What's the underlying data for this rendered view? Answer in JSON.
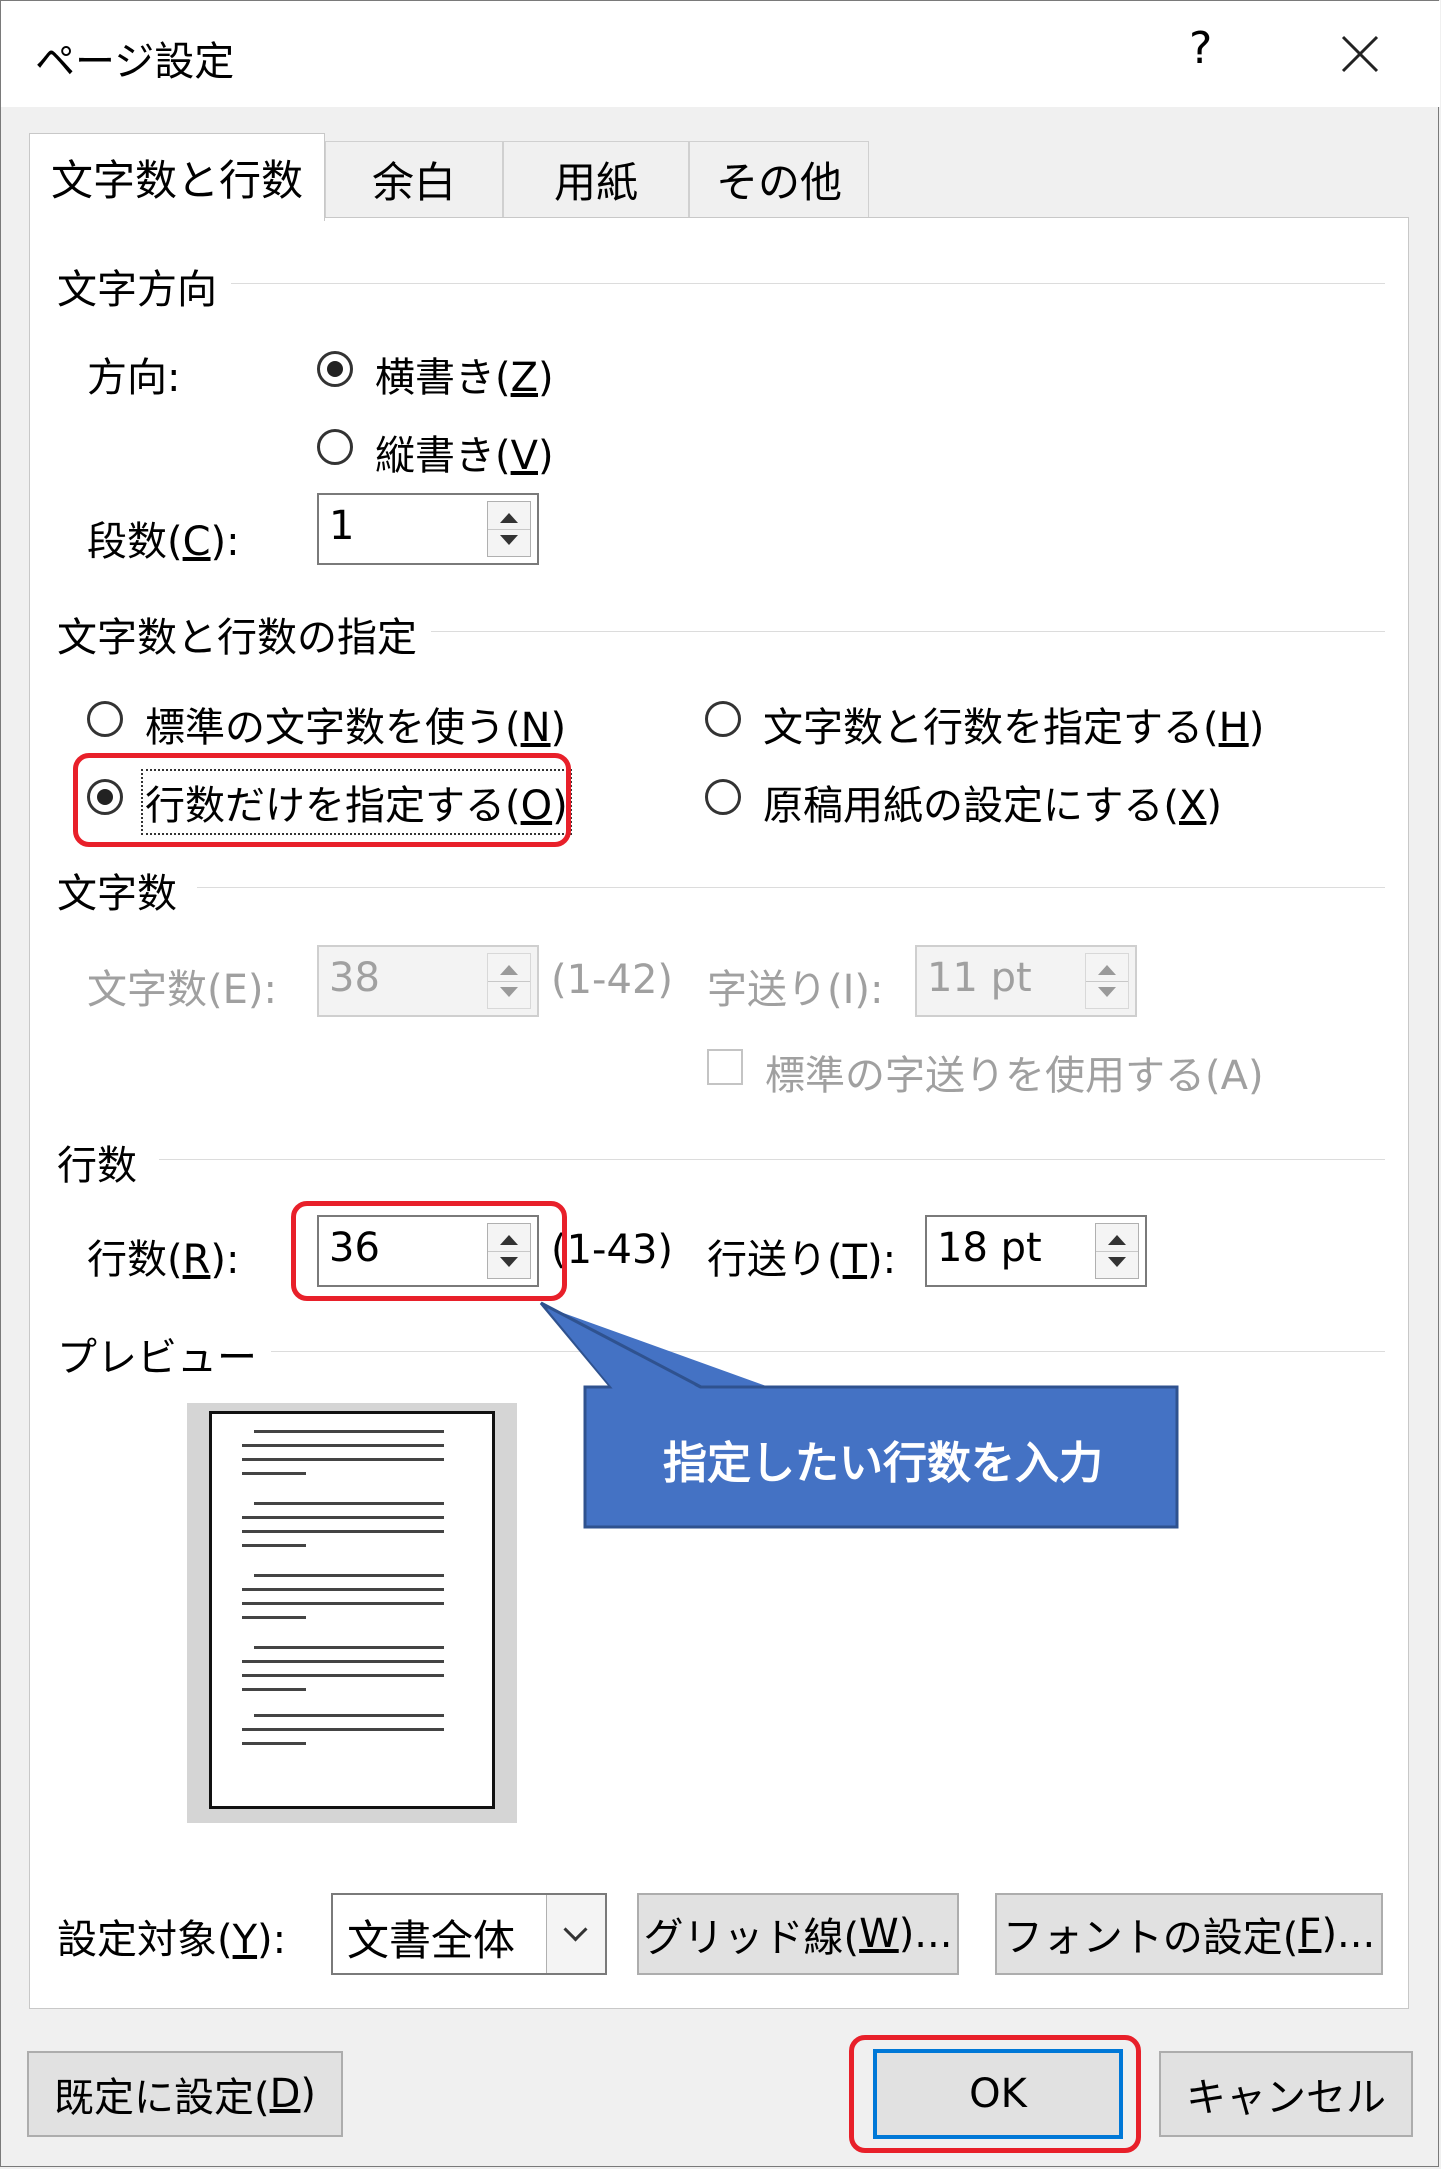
{
  "window": {
    "title": "ページ設定",
    "help": "?",
    "close": "✕"
  },
  "tabs": [
    {
      "label": "文字数と行数",
      "active": true
    },
    {
      "label": "余白",
      "active": false
    },
    {
      "label": "用紙",
      "active": false
    },
    {
      "label": "その他",
      "active": false
    }
  ],
  "direction_section": {
    "title": "文字方向",
    "direction_label": "方向:",
    "horizontal": {
      "text": "横書き(",
      "key": "Z",
      "end": ")",
      "checked": true
    },
    "vertical": {
      "text": "縦書き(",
      "key": "V",
      "end": ")",
      "checked": false
    },
    "columns_label": {
      "text": "段数(",
      "key": "C",
      "end": "):"
    },
    "columns_value": "1"
  },
  "grid_section": {
    "title": "文字数と行数の指定",
    "opt_standard": {
      "text": "標準の文字数を使う(",
      "key": "N",
      "end": ")",
      "checked": false
    },
    "opt_both": {
      "text": "文字数と行数を指定する(",
      "key": "H",
      "end": ")",
      "checked": false
    },
    "opt_lines_only": {
      "text": "行数だけを指定する(",
      "key": "O",
      "end": ")",
      "checked": true
    },
    "opt_genko": {
      "text": "原稿用紙の設定にする(",
      "key": "X",
      "end": ")",
      "checked": false
    }
  },
  "chars_section": {
    "title": "文字数",
    "chars_label": "文字数(E):",
    "chars_value": "38",
    "chars_range": "(1-42)",
    "pitch_label": "字送り(I):",
    "pitch_value": "11 pt",
    "use_standard_pitch": {
      "label": "標準の字送りを使用する(A)",
      "checked": false
    }
  },
  "lines_section": {
    "title": "行数",
    "lines_label": {
      "text": "行数(",
      "key": "R",
      "end": "):"
    },
    "lines_value": "36",
    "lines_range": "(1-43)",
    "pitch_label": {
      "text": "行送り(",
      "key": "T",
      "end": "):"
    },
    "pitch_value": "18 pt"
  },
  "preview": {
    "title": "プレビュー"
  },
  "callout": {
    "text": "指定したい行数を入力",
    "color": "#4472c4",
    "border": "#2f528f"
  },
  "apply_to": {
    "label": {
      "text": "設定対象(",
      "key": "Y",
      "end": "):"
    },
    "value": "文書全体"
  },
  "buttons": {
    "grid": {
      "text": "グリッド線(",
      "key": "W",
      "end": ")..."
    },
    "font": {
      "text": "フォントの設定(",
      "key": "F",
      "end": ")..."
    },
    "set_default": {
      "text": "既定に設定(",
      "key": "D",
      "end": ")"
    },
    "ok": "OK",
    "cancel": "キャンセル"
  },
  "highlight_color": "#e8202a"
}
